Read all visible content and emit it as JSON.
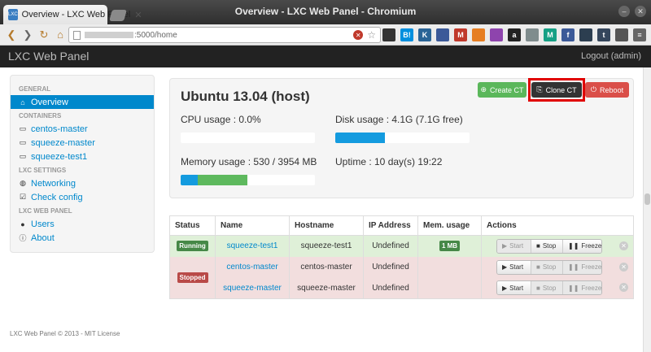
{
  "browser": {
    "window_title": "Overview - LXC Web Panel - Chromium",
    "tab_title": "Overview - LXC Web Panel",
    "favicon_text": "LXC",
    "url": ":5000/home",
    "extensions": [
      {
        "icon": "glasses-icon",
        "text": "",
        "color": "#333333"
      },
      {
        "icon": "hatena-icon",
        "text": "B!",
        "color": "#008fde"
      },
      {
        "icon": "k-icon",
        "text": "K",
        "color": "#2a6496"
      },
      {
        "icon": "square-icon",
        "text": "",
        "color": "#3b5998"
      },
      {
        "icon": "gmail-icon",
        "text": "M",
        "color": "#c0392b"
      },
      {
        "icon": "block-icon",
        "text": "",
        "color": "#e67e22"
      },
      {
        "icon": "leaf-icon",
        "text": "",
        "color": "#8e44ad"
      },
      {
        "icon": "amazon-icon",
        "text": "a",
        "color": "#222222"
      },
      {
        "icon": "gear-icon",
        "text": "",
        "color": "#7f8c8d"
      },
      {
        "icon": "m-icon",
        "text": "M",
        "color": "#16a085"
      },
      {
        "icon": "facebook-icon",
        "text": "f",
        "color": "#3b5998"
      },
      {
        "icon": "share-icon",
        "text": "",
        "color": "#2c3e50"
      },
      {
        "icon": "tumblr-icon",
        "text": "t",
        "color": "#35465c"
      },
      {
        "icon": "wrench-icon",
        "text": "",
        "color": "#555555"
      },
      {
        "icon": "menu-icon",
        "text": "≡",
        "color": "#666666"
      }
    ]
  },
  "navbar": {
    "brand": "LXC Web Panel",
    "logout": "Logout (admin)"
  },
  "sidebar": {
    "general_header": "GENERAL",
    "overview": "Overview",
    "containers_header": "CONTAINERS",
    "containers": [
      "centos-master",
      "squeeze-master",
      "squeeze-test1"
    ],
    "settings_header": "LXC SETTINGS",
    "networking": "Networking",
    "check_config": "Check config",
    "panel_header": "LXC WEB PANEL",
    "users": "Users",
    "about": "About"
  },
  "host": {
    "title": "Ubuntu 13.04 (host)",
    "cpu_usage": "CPU usage : 0.0%",
    "cpu_fraction": 0.0,
    "disk_usage": "Disk usage : 4.1G (7.1G free)",
    "disk_fraction": 0.37,
    "memory_usage": "Memory usage : 530 / 3954 MB",
    "memory_fraction_a": 0.13,
    "memory_fraction_b": 0.37,
    "uptime": "Uptime : 10 day(s) 19:22",
    "btn_create": "Create CT",
    "btn_clone": "Clone CT",
    "btn_reboot": "Reboot",
    "colors": {
      "bar_blue": "#149bdf",
      "bar_green": "#5eb95e",
      "create": "#5bb75b",
      "clone": "#333333",
      "reboot": "#da4f49"
    }
  },
  "table": {
    "headers": [
      "Status",
      "Name",
      "Hostname",
      "IP Address",
      "Mem. usage",
      "Actions"
    ],
    "status_running": "Running",
    "status_stopped": "Stopped",
    "rows": [
      {
        "name": "squeeze-test1",
        "hostname": "squeeze-test1",
        "ip": "Undefined",
        "mem": "1 MB"
      },
      {
        "name": "centos-master",
        "hostname": "centos-master",
        "ip": "Undefined",
        "mem": ""
      },
      {
        "name": "squeeze-master",
        "hostname": "squeeze-master",
        "ip": "Undefined",
        "mem": ""
      }
    ],
    "actions": {
      "start": "Start",
      "stop": "Stop",
      "freeze": "Freeze"
    }
  },
  "footer": "LXC Web Panel © 2013 - MIT License"
}
